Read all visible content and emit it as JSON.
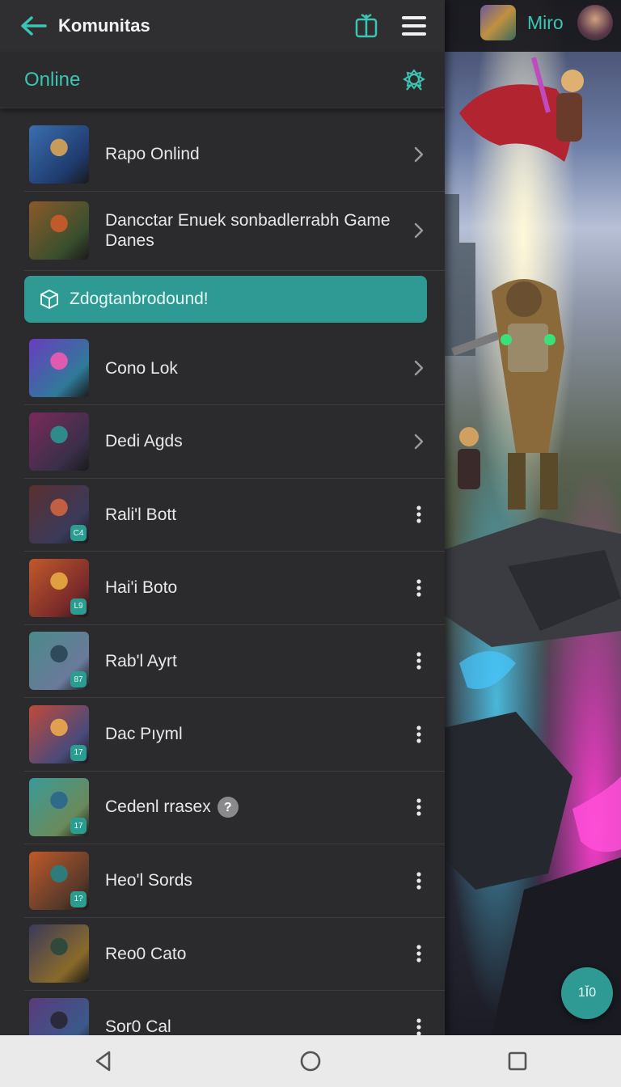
{
  "header": {
    "title": "Komunitas"
  },
  "section": {
    "label": "Online"
  },
  "profile": {
    "name": "Miro"
  },
  "promo": {
    "label": "Zdogtanbrodound!"
  },
  "items": [
    {
      "name": "Rapo Onlind",
      "action": "chevron",
      "colors": [
        "#3a6fb0",
        "#1f3b6e",
        "#c99b5b"
      ]
    },
    {
      "name": "Dancctar Enuek sonbadlerrabh Game Danes",
      "action": "chevron",
      "colors": [
        "#8a5a2a",
        "#3a4f2d",
        "#c05a2a"
      ]
    },
    {
      "name": "Cono Lok",
      "action": "chevron",
      "colors": [
        "#6a3cc0",
        "#2f7a9a",
        "#e05ab0"
      ]
    },
    {
      "name": "Dedi Agds",
      "action": "chevron",
      "colors": [
        "#7a2a5a",
        "#3a2f4a",
        "#2f8a8a"
      ]
    },
    {
      "name": "Rali'l Bott",
      "action": "menu",
      "badge": "C4",
      "colors": [
        "#5a3030",
        "#3a3a5a",
        "#c06040"
      ]
    },
    {
      "name": "Hai'i Boto",
      "action": "menu",
      "badge": "L9",
      "colors": [
        "#c05a2a",
        "#7a2a2a",
        "#e0a040"
      ]
    },
    {
      "name": "Rab'l Ayrt",
      "action": "menu",
      "badge": "87",
      "colors": [
        "#4a8a8a",
        "#6a7a9a",
        "#2f4a5a"
      ]
    },
    {
      "name": "Dac Pıyml",
      "action": "menu",
      "badge": "17",
      "colors": [
        "#c04a3a",
        "#4a4a7a",
        "#e0a050"
      ]
    },
    {
      "name": "Cedenl rrasex",
      "action": "menu",
      "badge": "17",
      "help": "?",
      "colors": [
        "#3a9a9a",
        "#6a8a5a",
        "#2f6a8a"
      ]
    },
    {
      "name": "Heo'l Sords",
      "action": "menu",
      "badge": "1?",
      "colors": [
        "#c05a2a",
        "#5a3a2a",
        "#2f7a7a"
      ]
    },
    {
      "name": "Reo0 Cato",
      "action": "menu",
      "colors": [
        "#3a3a5a",
        "#8a6a2a",
        "#2f4a3a"
      ]
    },
    {
      "name": "Sor0 Cal",
      "action": "menu",
      "colors": [
        "#5a3a7a",
        "#3a5a8a",
        "#2a2a3a"
      ]
    }
  ],
  "fab": {
    "label": "1Ĭ0"
  },
  "theme": {
    "accent": "#3cc5b3",
    "drawer": "#2b2b2d",
    "promo": "#2e9a93"
  }
}
